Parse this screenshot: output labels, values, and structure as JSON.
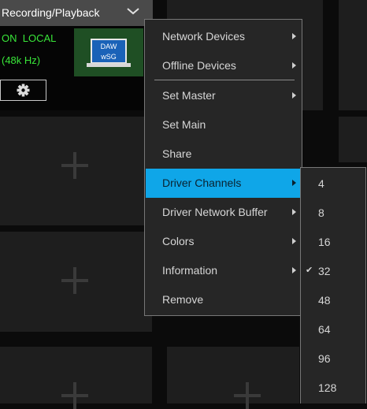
{
  "device": {
    "title": "Recording/Playback",
    "status_line": "ON  LOCAL",
    "sample_rate": "(48k Hz)",
    "thumbnail_text": [
      "DAW",
      "wSG"
    ]
  },
  "context_menu": {
    "items": [
      {
        "label": "Network Devices"
      },
      {
        "label": "Offline Devices"
      },
      {
        "label": "Set Master"
      },
      {
        "label": "Set Main"
      },
      {
        "label": "Share"
      },
      {
        "label": "Driver Channels"
      },
      {
        "label": "Driver Network Buffer"
      },
      {
        "label": "Colors"
      },
      {
        "label": "Information"
      },
      {
        "label": "Remove"
      }
    ]
  },
  "channels_submenu": {
    "items": [
      {
        "label": "4"
      },
      {
        "label": "8"
      },
      {
        "label": "16"
      },
      {
        "label": "32",
        "checked": true
      },
      {
        "label": "48"
      },
      {
        "label": "64"
      },
      {
        "label": "96"
      },
      {
        "label": "128"
      }
    ],
    "check_mark": "✔"
  },
  "colors": {
    "highlight": "#0fa6e8",
    "status_green": "#39e639",
    "menu_bg": "#262626"
  }
}
